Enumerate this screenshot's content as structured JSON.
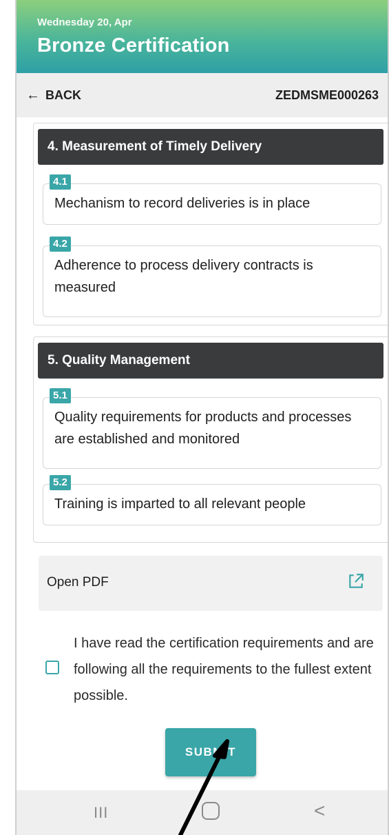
{
  "header": {
    "date": "Wednesday 20, Apr",
    "title": "Bronze Certification"
  },
  "subbar": {
    "back_arrow": "←",
    "back_label": "BACK",
    "reference": "ZEDMSME000263"
  },
  "sections": [
    {
      "title": "4. Measurement of Timely Delivery",
      "items": [
        {
          "badge": "4.1",
          "text": "Mechanism to record deliveries is in place"
        },
        {
          "badge": "4.2",
          "text": "Adherence to process delivery contracts is measured"
        }
      ]
    },
    {
      "title": "5. Quality Management",
      "items": [
        {
          "badge": "5.1",
          "text": "Quality requirements for products and processes are established and monitored"
        },
        {
          "badge": "5.2",
          "text": "Training is imparted to all relevant people"
        }
      ]
    }
  ],
  "pdf": {
    "label": "Open PDF",
    "icon": "external-link-icon"
  },
  "agreement": {
    "text": "I have read the certification requirements and are following all the requirements to the fullest extent possible.",
    "checked": false
  },
  "submit": {
    "label": "SUBMIT"
  },
  "navbar": {
    "recent_glyph": "III",
    "back_glyph": "<"
  },
  "colors": {
    "accent": "#3aa6a8",
    "section_header": "#3a3b3d",
    "header_top": "#8ccf7d",
    "header_bottom": "#2ea0a6"
  }
}
